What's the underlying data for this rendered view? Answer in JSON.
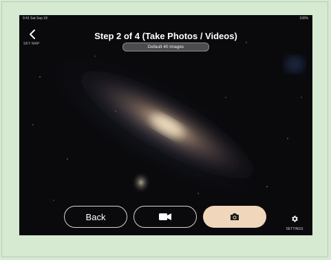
{
  "status_bar": {
    "time": "9:41  Sat Sep 18",
    "right": "100%"
  },
  "nav": {
    "back_caption": "SKY MAP"
  },
  "header": {
    "title": "Step 2 of 4  (Take Photos / Videos)",
    "subtitle": "Default 40 images"
  },
  "controls": {
    "back_label": "Back",
    "video_icon": "video-camera-icon",
    "photo_icon": "camera-icon"
  },
  "settings": {
    "label": "SETTINGS",
    "icon": "gear-icon"
  },
  "colors": {
    "outer_bg": "#d6ead2",
    "screen_bg": "#0a0a0d",
    "photo_button": "#f0d7bb",
    "text": "#ffffff"
  }
}
